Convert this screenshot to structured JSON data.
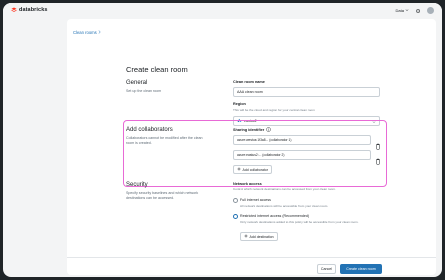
{
  "app": {
    "name": "databricks"
  },
  "topbar": {
    "user": "Data"
  },
  "breadcrumb": {
    "label": "Clean rooms"
  },
  "page": {
    "title": "Create clean room"
  },
  "general": {
    "title": "General",
    "description": "Set up the clean room",
    "name_label": "Clean room name",
    "name_value": "AAA clean room",
    "region_label": "Region",
    "region_help": "This will be the cloud and region for your central clean room",
    "region_value": "eastus2"
  },
  "collaborators": {
    "title": "Add collaborators",
    "description": "Collaborators cannot be modified after the clean room is created.",
    "sharing_label": "Sharing identifier",
    "identifiers": [
      "azure:westus:1f3a8... (collaborator 1)",
      "azure:eastus2:... (collaborator 2)"
    ],
    "add_label": "Add collaborator"
  },
  "security": {
    "title": "Security",
    "description": "Specify security baselines and which network destinations can be accessed.",
    "network_label": "Network access",
    "network_help": "Control which network destinations can be accessed from your clean room.",
    "option_full_label": "Full internet access",
    "option_full_help": "All network destinations will be accessible from your clean room.",
    "option_restricted_label": "Restricted internet access (Recommended)",
    "option_restricted_help": "Only network destinations added to this policy will be accessible from your clean room.",
    "add_destination_label": "Add destination",
    "selected_option": "restricted"
  },
  "footer": {
    "cancel_label": "Cancel",
    "create_label": "Create clean room"
  },
  "colors": {
    "accent": "#2272b4",
    "highlight": "#e86ad6",
    "logo": "#ff3621"
  }
}
